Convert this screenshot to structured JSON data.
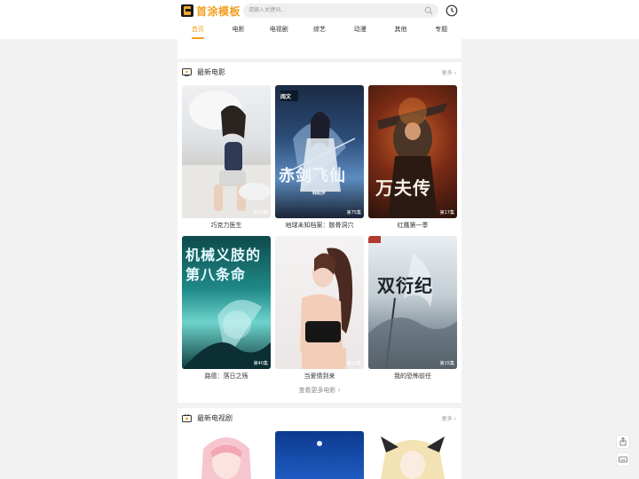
{
  "header": {
    "logo_text": "首涂模板",
    "search_placeholder": "请输入关键词...",
    "nav": [
      "首页",
      "电影",
      "电视剧",
      "综艺",
      "动漫",
      "其他",
      "专题"
    ],
    "active_nav": "首页"
  },
  "sections": {
    "movies": {
      "title": "最新电影",
      "more": "更多",
      "items": [
        {
          "title": "巧克力医生",
          "ep": "第34集"
        },
        {
          "title": "地球未知档案：骸骨洞穴",
          "ep": "第75集",
          "poster_text": "赤剑飞仙",
          "poster_sub": "韩甜梦",
          "poster_brand": "阅文"
        },
        {
          "title": "红鹰第一季",
          "ep": "第17集",
          "poster_text": "万夫传"
        },
        {
          "title": "路德：落日之殇",
          "ep": "第40集",
          "poster_text_1": "机械义肢的",
          "poster_text_2": "第八条命"
        },
        {
          "title": "当爱情到来",
          "ep": "第12集"
        },
        {
          "title": "我的恐怖前任",
          "ep": "第15集",
          "poster_text": "双衍纪"
        }
      ],
      "view_more": "查看更多电影"
    },
    "tv": {
      "title": "最新电视剧",
      "more": "更多"
    }
  },
  "colors": {
    "accent": "#f29d1d",
    "background": "#f2f2f2"
  }
}
